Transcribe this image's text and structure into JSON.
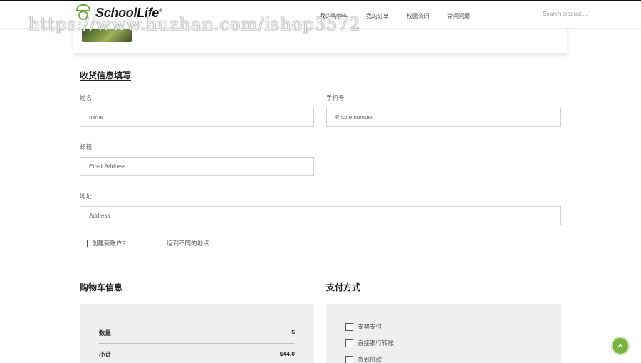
{
  "watermark": "https://www.huzhan.com/ishop3572",
  "header": {
    "logo_part1": "School",
    "logo_part2": "Life",
    "logo_mark": "®",
    "nav": [
      "我的购物车",
      "我的订单",
      "校园资讯",
      "常问问题"
    ],
    "search_placeholder": "Search product ..."
  },
  "shipping": {
    "title": "收货信息填写",
    "name_label": "姓名",
    "name_placeholder": "name",
    "phone_label": "手机号",
    "phone_placeholder": "Phone number",
    "email_label": "邮箱",
    "email_placeholder": "Email Address",
    "address_label": "地址",
    "address_placeholder": "Address",
    "create_account": "创建新账户?",
    "ship_different": "运到不同的地点"
  },
  "cart_info": {
    "title": "购物车信息",
    "rows": [
      {
        "label": "数量",
        "value": "5"
      },
      {
        "label": "小计",
        "value": "$44.0"
      }
    ]
  },
  "payment": {
    "title": "支付方式",
    "options": [
      "支票支付",
      "直接银行转账",
      "货到付款"
    ]
  },
  "colors": {
    "brand_green": "#78b33e",
    "panel_bg": "#efefef"
  },
  "icons": {
    "back_to_top": "chevron-up-icon"
  }
}
